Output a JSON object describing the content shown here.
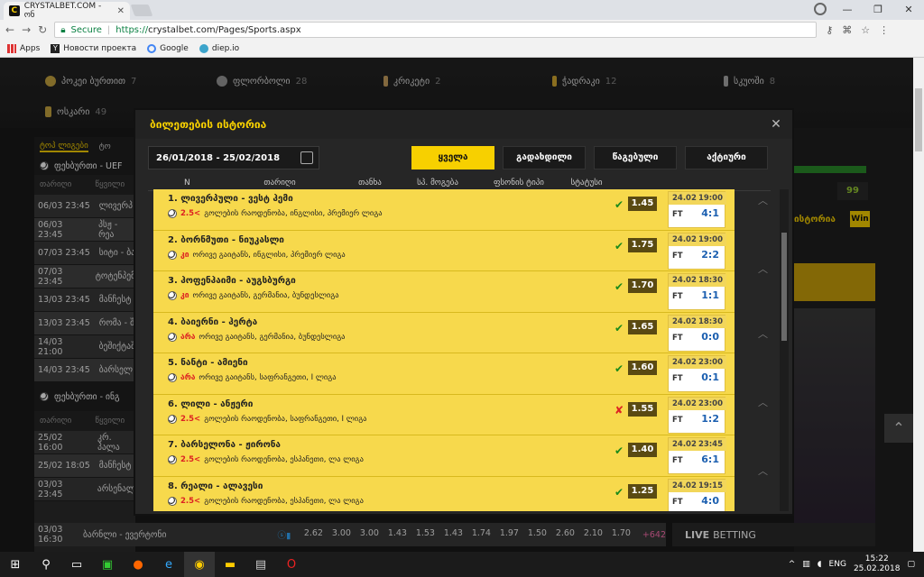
{
  "browser": {
    "tab_title": "CRYSTALBET.COM - ონ",
    "secure_label": "Secure",
    "url_scheme": "https://",
    "url_rest": "crystalbet.com/Pages/Sports.aspx",
    "bookmarks": [
      "Apps",
      "Новости проекта",
      "Google",
      "diep.io"
    ]
  },
  "sports": [
    {
      "label": "პოკეი ბურთით",
      "count": "7"
    },
    {
      "label": "ფლორბოლი",
      "count": "28"
    },
    {
      "label": "კრიკეტი",
      "count": "2"
    },
    {
      "label": "ჭადრაკი",
      "count": "12"
    },
    {
      "label": "სკუოში",
      "count": "8"
    },
    {
      "label": "ოსკარი",
      "count": "49"
    }
  ],
  "left": {
    "tabs": [
      "ტოპ ლიგები",
      "ტო"
    ],
    "section1": "ფეხბურთი - UEF",
    "section2": "ფეხბურთი - ინგ",
    "sub": [
      "თარიღი",
      "წყვილი"
    ],
    "rows1": [
      {
        "time": "06/03 23:45",
        "name": "ლივერპ"
      },
      {
        "time": "06/03 23:45",
        "name": "პსჟ - რეა"
      },
      {
        "time": "07/03 23:45",
        "name": "სიტი - ბა"
      },
      {
        "time": "07/03 23:45",
        "name": "ტოტენპემ"
      },
      {
        "time": "13/03 23:45",
        "name": "მანჩესტ"
      },
      {
        "time": "13/03 23:45",
        "name": "რომა - შ"
      },
      {
        "time": "14/03 21:00",
        "name": "ბეშიქტაშ"
      },
      {
        "time": "14/03 23:45",
        "name": "ბარსელ"
      }
    ],
    "rows2": [
      {
        "time": "25/02 16:00",
        "name": "კრ. პალა"
      },
      {
        "time": "25/02 18:05",
        "name": "მანჩესტ"
      },
      {
        "time": "03/03 23:45",
        "name": "არსენალ"
      }
    ]
  },
  "bottom_row": {
    "time": "03/03 16:30",
    "name": "ბარნლი - ევერტონი",
    "odds": [
      "2.62",
      "3.00",
      "3.00",
      "1.43",
      "1.53",
      "1.43",
      "1.74",
      "1.97",
      "1.50",
      "2.60",
      "2.10",
      "1.70"
    ],
    "plus": "+642"
  },
  "live_betting": {
    "bold": "LIVE",
    "rest": "BETTING"
  },
  "right_panel": {
    "balance": "99",
    "history_label": "ისტორია",
    "win_badge": "Win"
  },
  "modal": {
    "title": "ბილეთების ისტორია",
    "date_range": "26/01/2018 - 25/02/2018",
    "filters": [
      "ყველა",
      "გადახდილი",
      "წაგებული",
      "აქტიური"
    ],
    "columns": [
      "N",
      "თარიღი",
      "თანხა",
      "სპ. მოგება",
      "ფსონის ტიპი",
      "სტატუსი"
    ],
    "bets": [
      {
        "title": "1. ლივერპული - ვესტ ჰემი",
        "pick": "2.5<",
        "desc": "გოლების რაოდენობა, ინგლისი, პრემიერ ლიგა",
        "status": "win",
        "odd": "1.45",
        "date": "24.02",
        "time": "19:00",
        "score": "4:1"
      },
      {
        "title": "2. ბორნმუთი - ნიუკასლი",
        "pick": "კი",
        "desc": "ორივე გაიტანს, ინგლისი, პრემიერ ლიგა",
        "status": "win",
        "odd": "1.75",
        "date": "24.02",
        "time": "19:00",
        "score": "2:2"
      },
      {
        "title": "3. ჰოფენჰაიმი - აუგსბურგი",
        "pick": "კი",
        "desc": "ორივე გაიტანს, გერმანია, ბუნდესლიგა",
        "status": "win",
        "odd": "1.70",
        "date": "24.02",
        "time": "18:30",
        "score": "1:1"
      },
      {
        "title": "4. ბაიერნი - ჰერტა",
        "pick": "არა",
        "desc": "ორივე გაიტანს, გერმანია, ბუნდესლიგა",
        "status": "win",
        "odd": "1.65",
        "date": "24.02",
        "time": "18:30",
        "score": "0:0"
      },
      {
        "title": "5. ნანტი - ამიენი",
        "pick": "არა",
        "desc": "ორივე გაიტანს, საფრანგეთი, I ლიგა",
        "status": "win",
        "odd": "1.60",
        "date": "24.02",
        "time": "23:00",
        "score": "0:1"
      },
      {
        "title": "6. ლილი - ანჟერი",
        "pick": "2.5<",
        "desc": "გოლების რაოდენობა, საფრანგეთი, I ლიგა",
        "status": "lose",
        "odd": "1.55",
        "date": "24.02",
        "time": "23:00",
        "score": "1:2"
      },
      {
        "title": "7. ბარსელონა - ჟირონა",
        "pick": "2.5<",
        "desc": "გოლების რაოდენობა, ესპანეთი, ლა ლიგა",
        "status": "win",
        "odd": "1.40",
        "date": "24.02",
        "time": "23:45",
        "score": "6:1"
      },
      {
        "title": "8. რეალი - ალავესი",
        "pick": "2.5<",
        "desc": "გოლების რაოდენობა, ესპანეთი, ლა ლიგა",
        "status": "win",
        "odd": "1.25",
        "date": "24.02",
        "time": "19:15",
        "score": "4:0"
      }
    ],
    "ft_label": "FT"
  },
  "taskbar": {
    "lang": "ENG",
    "time": "15:22",
    "date": "25.02.2018"
  },
  "colors": {
    "accent": "#f7d000",
    "win": "#1a8a1a",
    "lose": "#dd2222",
    "score": "#1b5fb0"
  }
}
